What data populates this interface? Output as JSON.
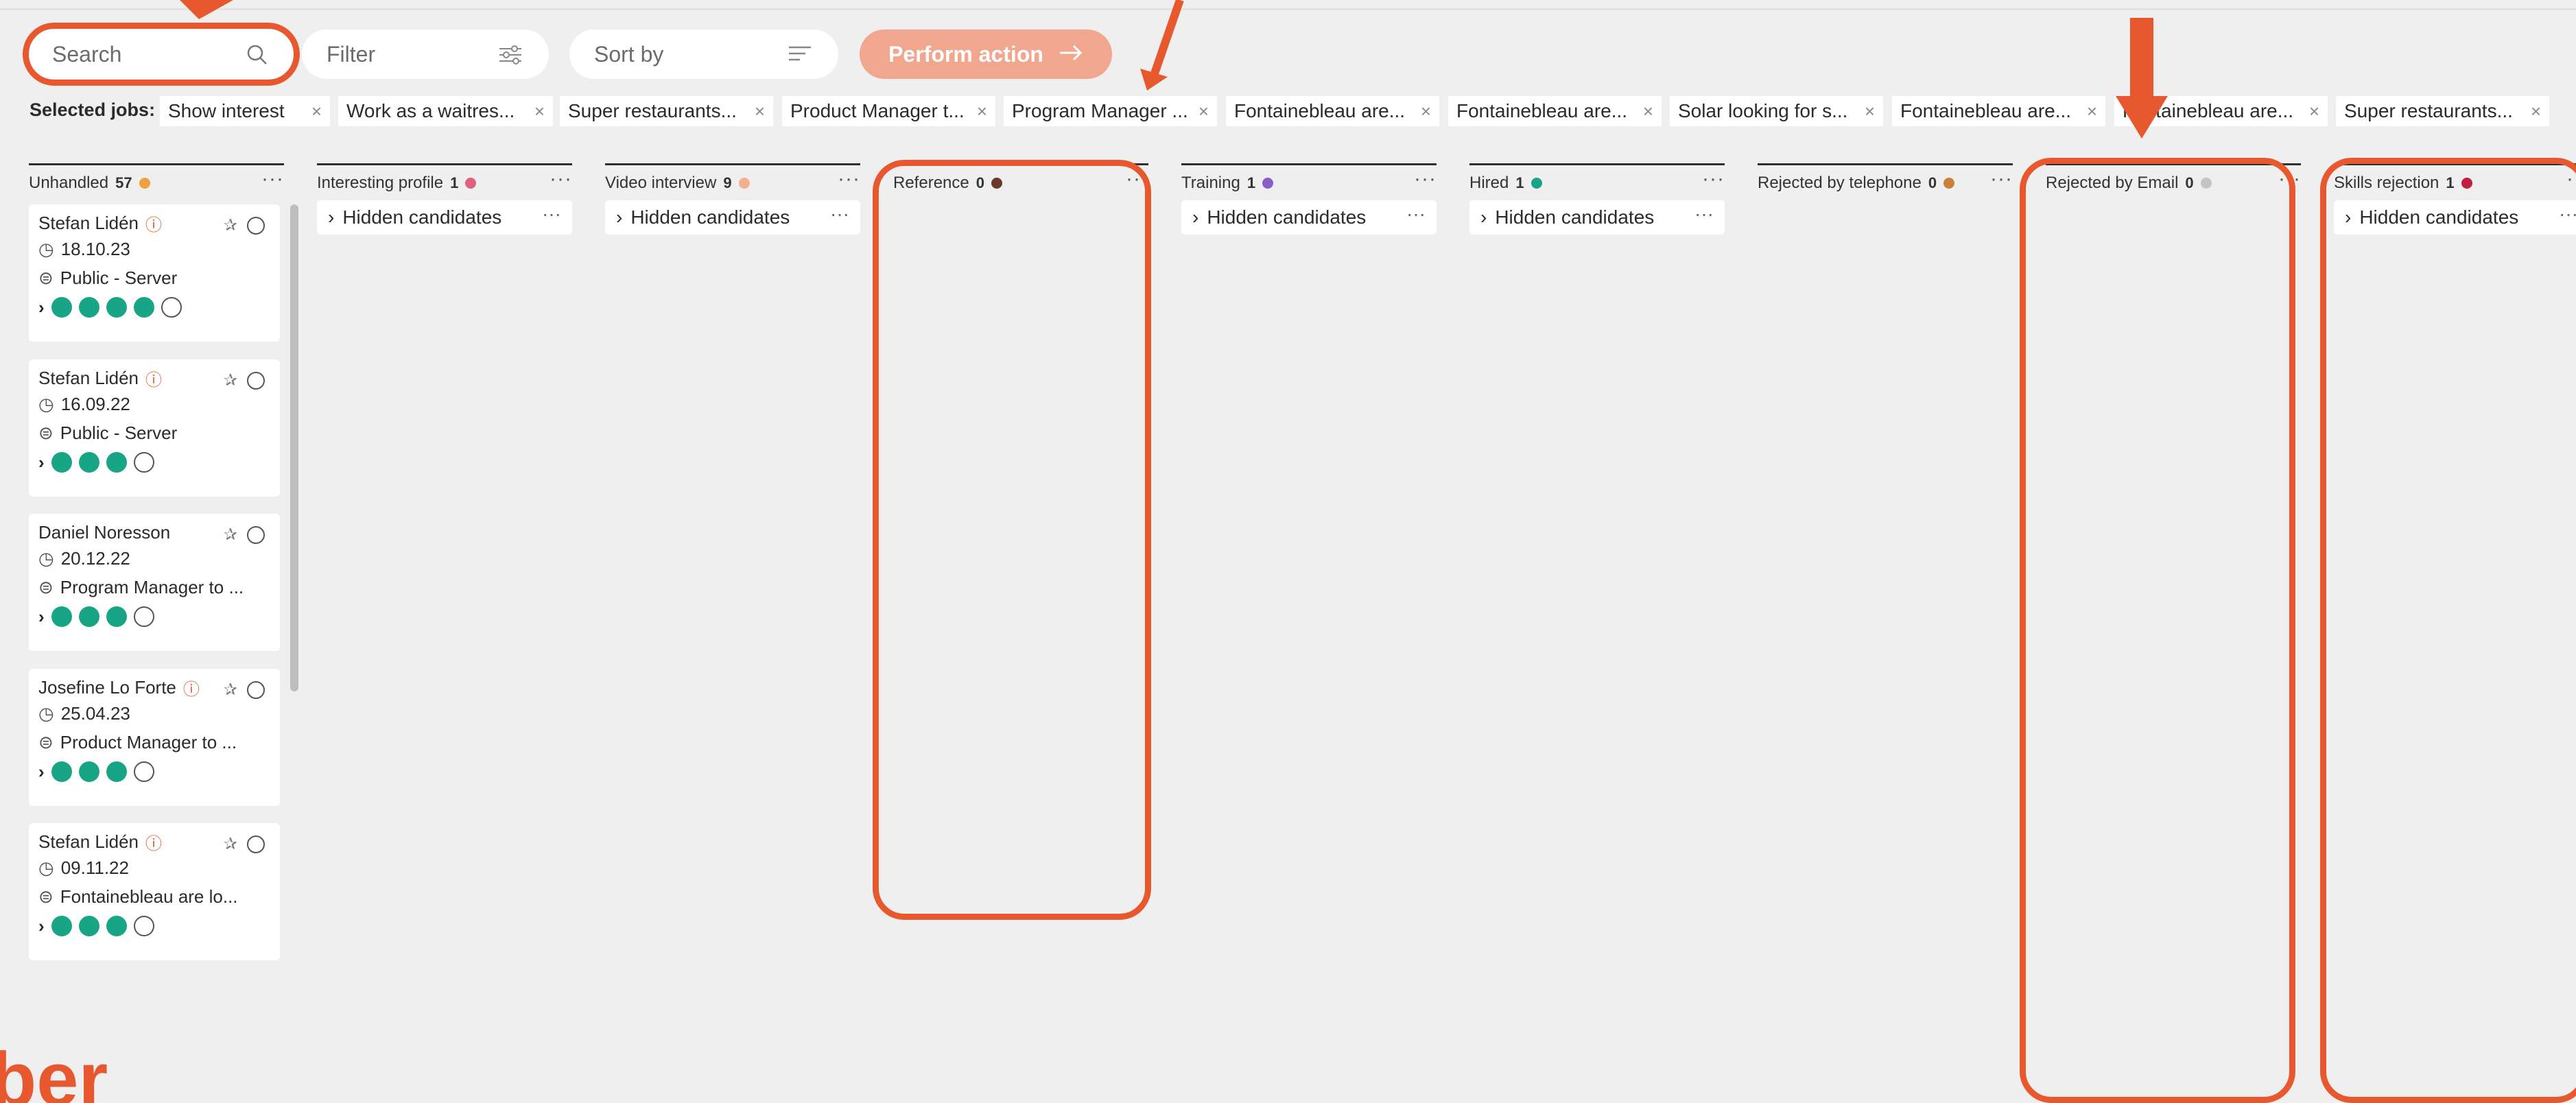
{
  "toolbar": {
    "search_placeholder": "Search",
    "filter_label": "Filter",
    "sort_label": "Sort by",
    "action_label": "Perform action"
  },
  "selected_jobs": {
    "label": "Selected jobs:",
    "chips": [
      "Show interest",
      "Work as a waitres...",
      "Super restaurants...",
      "Product Manager t...",
      "Program Manager ...",
      "Fontainebleau are...",
      "Fontainebleau are...",
      "Solar looking for s...",
      "Fontainebleau are...",
      "Fontainebleau are...",
      "Super restaurants..."
    ]
  },
  "columns": [
    {
      "title": "Unhandled",
      "count": "57",
      "color": "#f0a040"
    },
    {
      "title": "Interesting profile",
      "count": "1",
      "color": "#e0607a"
    },
    {
      "title": "Video interview",
      "count": "9",
      "color": "#f4b08a"
    },
    {
      "title": "Reference",
      "count": "0",
      "color": "#6b3a2e"
    },
    {
      "title": "Training",
      "count": "1",
      "color": "#8a5cc8"
    },
    {
      "title": "Hired",
      "count": "1",
      "color": "#17a585"
    },
    {
      "title": "Rejected by telephone",
      "count": "0",
      "color": "#c8803a"
    },
    {
      "title": "Rejected by Email",
      "count": "0",
      "color": "#c4c4c4"
    },
    {
      "title": "Skills rejection",
      "count": "1",
      "color": "#c02040"
    }
  ],
  "hidden_label": "Hidden candidates",
  "cards": [
    {
      "name": "Stefan Lidén",
      "warn": true,
      "date": "18.10.23",
      "job": "Public - Server",
      "icons": 4
    },
    {
      "name": "Stefan Lidén",
      "warn": true,
      "date": "16.09.22",
      "job": "Public - Server",
      "icons": 3
    },
    {
      "name": "Daniel Noresson",
      "warn": false,
      "date": "20.12.22",
      "job": "Program Manager to ...",
      "icons": 3
    },
    {
      "name": "Josefine Lo Forte",
      "warn": true,
      "date": "25.04.23",
      "job": "Product Manager to ...",
      "icons": 3
    },
    {
      "name": "Stefan Lidén",
      "warn": true,
      "date": "09.11.22",
      "job": "Fontainebleau are lo...",
      "icons": 3
    }
  ],
  "overlay_text": "ber",
  "colors": {
    "accent": "#e8582e",
    "action_button": "#f1a78e",
    "icon_green": "#17a585"
  }
}
